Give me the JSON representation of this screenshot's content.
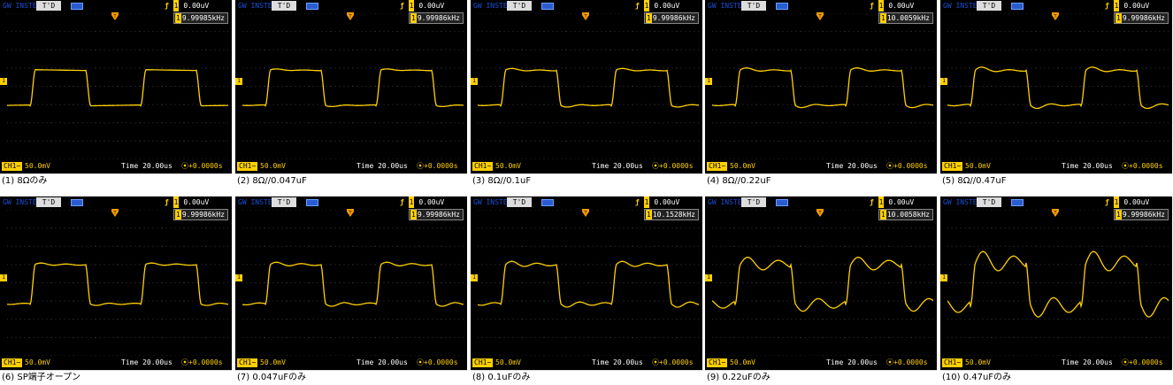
{
  "colors": {
    "trace": "#ffd000",
    "grid": "#5a5a5a",
    "screen": "#000000",
    "accent": "#ffd000"
  },
  "scope_common": {
    "brand": "GW INSTEK",
    "trigger_status": "T'D",
    "trigger_level": "0.00uV",
    "channel_label": "CH1",
    "volt_div": "50.0mV",
    "time_base": "Time 20.00us",
    "time_delay": "0.0000s"
  },
  "captures": [
    {
      "freq": "9.99985kHz",
      "caption": "(1) 8Ωのみ",
      "wave": {
        "amp": 0.45,
        "ring": 0.0,
        "tilt": 0.05,
        "shape": 0
      }
    },
    {
      "freq": "9.99986kHz",
      "caption": "(2) 8Ω//0.047uF",
      "wave": {
        "amp": 0.45,
        "ring": 0.06,
        "tilt": 0.05,
        "shape": 0
      }
    },
    {
      "freq": "9.99986kHz",
      "caption": "(3) 8Ω//0.1uF",
      "wave": {
        "amp": 0.45,
        "ring": 0.1,
        "tilt": 0.06,
        "shape": 0
      }
    },
    {
      "freq": "10.0059kHz",
      "caption": "(4) 8Ω//0.22uF",
      "wave": {
        "amp": 0.45,
        "ring": 0.14,
        "tilt": 0.06,
        "shape": 0
      }
    },
    {
      "freq": "9.99986kHz",
      "caption": "(5) 8Ω//0.47uF",
      "wave": {
        "amp": 0.45,
        "ring": 0.2,
        "tilt": 0.07,
        "shape": 0
      }
    },
    {
      "freq": "9.99986kHz",
      "caption": "(6) SP端子オープン",
      "wave": {
        "amp": 0.5,
        "ring": 0.07,
        "tilt": 0.04,
        "shape": 1
      }
    },
    {
      "freq": "9.99986kHz",
      "caption": "(7) 0.047uFのみ",
      "wave": {
        "amp": 0.5,
        "ring": 0.12,
        "tilt": 0.04,
        "shape": 1
      }
    },
    {
      "freq": "10.1528kHz",
      "caption": "(8) 0.1uFのみ",
      "wave": {
        "amp": 0.5,
        "ring": 0.17,
        "tilt": 0.04,
        "shape": 1
      }
    },
    {
      "freq": "10.0058kHz",
      "caption": "(9) 0.22uFのみ",
      "wave": {
        "amp": 0.5,
        "ring": 0.3,
        "tilt": 0.03,
        "shape": 2
      }
    },
    {
      "freq": "9.99986kHz",
      "caption": "(10) 0.47uFのみ",
      "wave": {
        "amp": 0.55,
        "ring": 0.42,
        "tilt": 0.03,
        "shape": 2
      }
    }
  ]
}
